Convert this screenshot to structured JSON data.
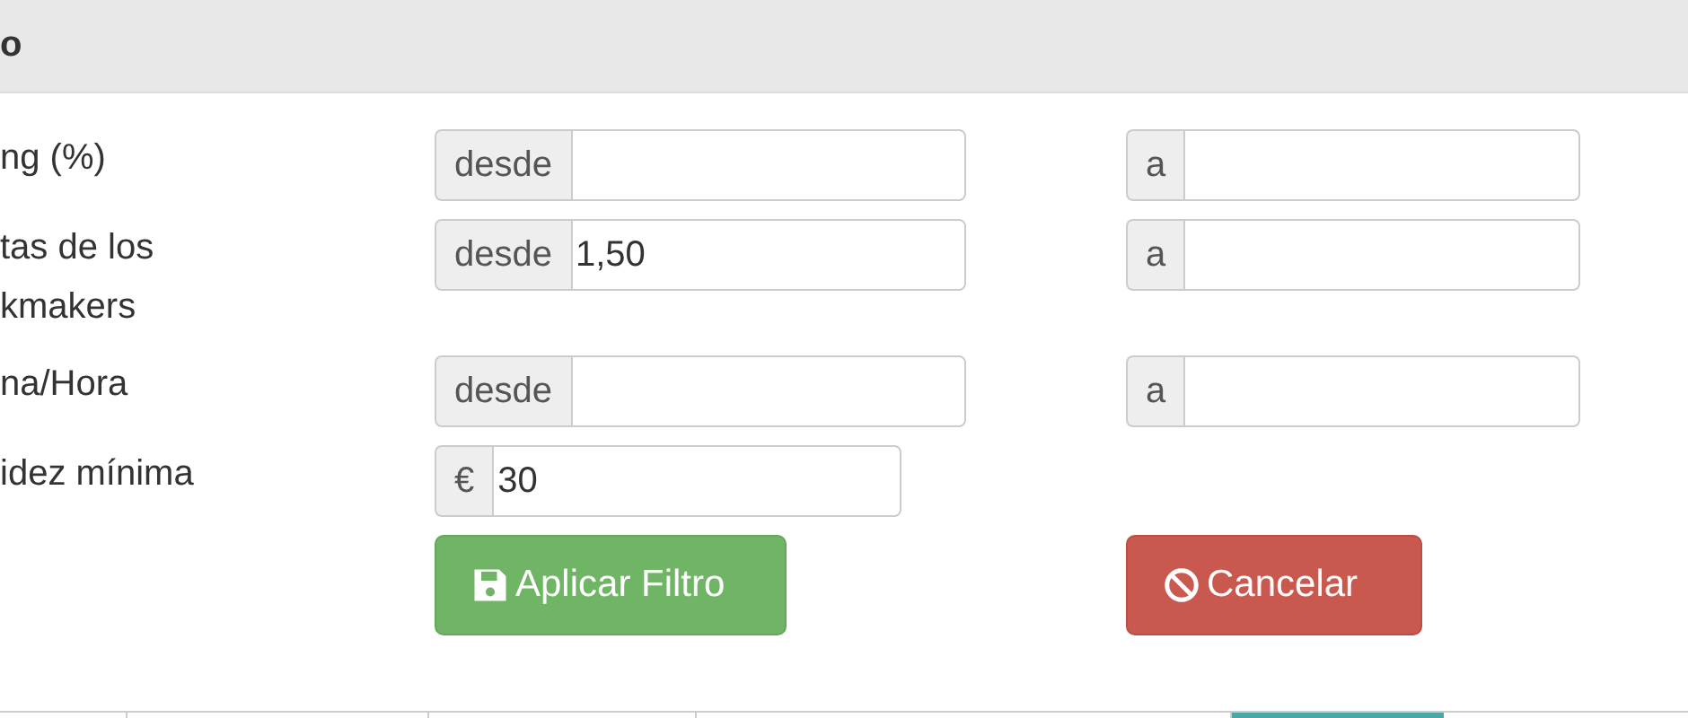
{
  "panel": {
    "title": "o"
  },
  "filters": [
    {
      "kind": "range",
      "label": "ng (%)",
      "from": {
        "addon": "desde"
      },
      "to": {
        "addon": "a"
      }
    },
    {
      "kind": "range",
      "label": "tas de los\nkmakers",
      "from": {
        "addon": "desde",
        "value": "1,50"
      },
      "to": {
        "addon": "a"
      }
    },
    {
      "kind": "range",
      "label": "na/Hora",
      "from": {
        "addon": "desde"
      },
      "to": {
        "addon": "a"
      }
    },
    {
      "kind": "single",
      "label": "idez mínima",
      "addon": "€",
      "value": "30"
    }
  ],
  "buttons": [
    {
      "kind": "apply",
      "label": "Aplicar Filtro"
    },
    {
      "kind": "cancel",
      "label": "Cancelar"
    }
  ]
}
